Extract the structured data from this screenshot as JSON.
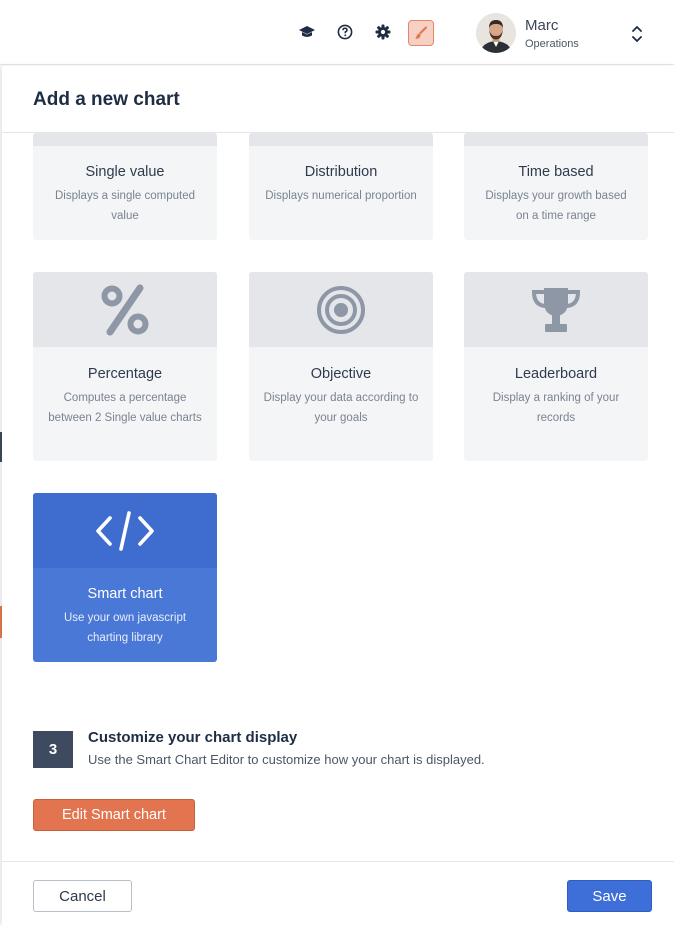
{
  "topbar": {
    "icons": [
      "graduation-cap-icon",
      "help-icon",
      "gear-icon",
      "brush-icon"
    ],
    "user": {
      "name": "Marc",
      "role": "Operations"
    }
  },
  "panel": {
    "title": "Add a new chart",
    "cards": [
      {
        "title": "Single value",
        "desc": "Displays a single computed value",
        "icon": "",
        "selected": false
      },
      {
        "title": "Distribution",
        "desc": "Displays numerical proportion",
        "icon": "",
        "selected": false
      },
      {
        "title": "Time based",
        "desc": "Displays your growth based on a time range",
        "icon": "",
        "selected": false
      },
      {
        "title": "Percentage",
        "desc": "Computes a percentage between 2 Single value charts",
        "icon": "percent-icon",
        "selected": false
      },
      {
        "title": "Objective",
        "desc": "Display your data according to your goals",
        "icon": "target-icon",
        "selected": false
      },
      {
        "title": "Leaderboard",
        "desc": "Display a ranking of your records",
        "icon": "trophy-icon",
        "selected": false
      },
      {
        "title": "Smart chart",
        "desc": "Use your own javascript charting library",
        "icon": "code-icon",
        "selected": true
      }
    ],
    "step": {
      "number": "3",
      "title": "Customize your chart display",
      "desc": "Use the Smart Chart Editor to customize how your chart is displayed."
    },
    "edit_button": "Edit Smart chart",
    "cancel_button": "Cancel",
    "save_button": "Save"
  },
  "colors": {
    "accent": "#3e6fd8",
    "edit_button": "#e2754f",
    "selected_card": "#4a78d6",
    "step_badge": "#3e4a60"
  }
}
